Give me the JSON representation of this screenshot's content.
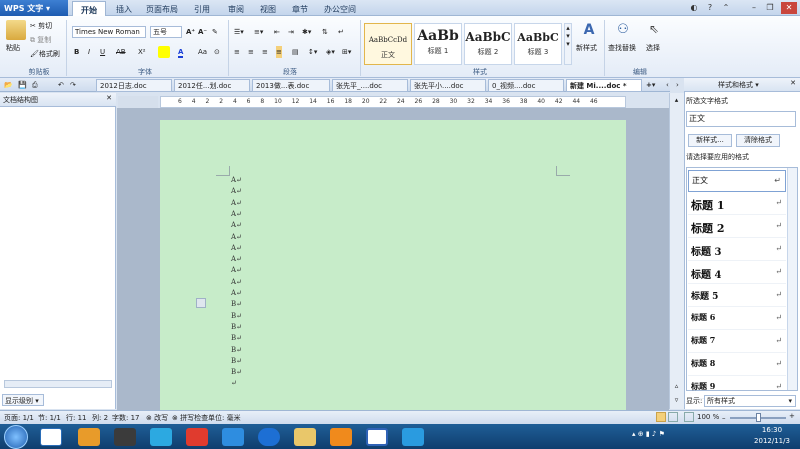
{
  "titlebar": {
    "app_name": "WPS 文字",
    "tabs": [
      "开始",
      "插入",
      "页面布局",
      "引用",
      "审阅",
      "视图",
      "章节",
      "办公空间"
    ]
  },
  "ribbon": {
    "clipboard": {
      "paste": "粘贴",
      "cut": "剪切",
      "copy": "复制",
      "format_painter": "格式刷",
      "label": "剪贴板"
    },
    "font": {
      "name": "Times New Roman",
      "size": "五号",
      "label": "字体"
    },
    "paragraph": {
      "label": "段落"
    },
    "styles": {
      "cards": [
        {
          "preview": "AaBbCcDd",
          "caption": "正文"
        },
        {
          "preview": "AaBb",
          "caption": "标题 1"
        },
        {
          "preview": "AaBbC",
          "caption": "标题 2"
        },
        {
          "preview": "AaBbC",
          "caption": "标题 3"
        }
      ],
      "new_style": "新样式",
      "label": "样式"
    },
    "editing": {
      "find_replace": "查找替换",
      "select": "选择",
      "label": "编辑"
    }
  },
  "doc_tabs": [
    "2012日志.doc",
    "2012任...划.doc",
    "2013做...表.doc",
    "张先平_....doc",
    "张先平小....doc",
    "0_视频....doc",
    "新建 Mi....doc *"
  ],
  "left_pane": {
    "title": "文档结构图",
    "display_level": "显示级别"
  },
  "ruler_ticks": [
    "6",
    "4",
    "2",
    "2",
    "4",
    "6",
    "8",
    "10",
    "12",
    "14",
    "16",
    "18",
    "20",
    "22",
    "24",
    "26",
    "28",
    "30",
    "32",
    "34",
    "36",
    "38",
    "40",
    "42",
    "44",
    "46"
  ],
  "document": {
    "lines": [
      "A↵",
      "A↵",
      "A↵",
      "A↵",
      "A↵",
      "A↵",
      "A↵",
      "A↵",
      "A↵",
      "A↵",
      "A↵",
      "B↵",
      "B↵",
      "B↵",
      "B↵",
      "B↵",
      "B↵",
      "B↵",
      "↵"
    ]
  },
  "right_pane": {
    "title": "样式和格式",
    "selected_label": "所选文字格式",
    "selected_value": "正文",
    "new_style_btn": "新样式...",
    "clear_format_btn": "清除格式",
    "apply_label": "请选择要应用的格式",
    "styles": [
      {
        "name": "正文",
        "size": 8
      },
      {
        "name": "标题 1",
        "size": 11
      },
      {
        "name": "标题 2",
        "size": 11
      },
      {
        "name": "标题 3",
        "size": 10
      },
      {
        "name": "标题 4",
        "size": 10
      },
      {
        "name": "标题 5",
        "size": 9
      },
      {
        "name": "标题 6",
        "size": 8
      },
      {
        "name": "标题 7",
        "size": 8
      },
      {
        "name": "标题 8",
        "size": 8
      },
      {
        "name": "标题 9",
        "size": 8
      }
    ],
    "show_label": "显示:",
    "show_value": "所有样式"
  },
  "statusbar": {
    "page": "页面: 1/1",
    "section": "节: 1/1",
    "row": "行: 11",
    "col": "列: 2",
    "words": "字数: 17",
    "overwrite": "改写",
    "spellcheck": "拼写检查",
    "unit": "单位: 毫米",
    "zoom": "100 %"
  },
  "taskbar": {
    "time": "16:30",
    "date": "2012/11/3"
  },
  "colors": {
    "page_bg": "#c7ecc9",
    "ribbon_bg": "#e4ecf7",
    "taskbar": "#1f5e97"
  }
}
